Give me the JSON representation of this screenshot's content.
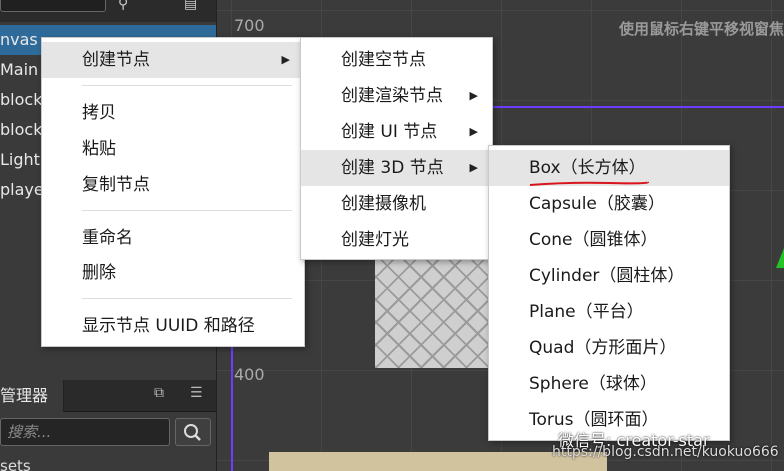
{
  "hierarchy": {
    "rows": [
      "nvas",
      "Main C",
      "block",
      "block",
      "Light",
      "player"
    ]
  },
  "assets": {
    "tab_label": "管理器",
    "search_placeholder": "搜索...",
    "first_row": "sets"
  },
  "scene": {
    "hint": "使用鼠标右键平移视窗焦",
    "label_700": "700",
    "label_400": "400"
  },
  "menu_main": {
    "items": [
      "创建节点",
      "拷贝",
      "粘贴",
      "复制节点",
      "重命名",
      "删除",
      "显示节点 UUID 和路径"
    ]
  },
  "menu_create": {
    "items": [
      "创建空节点",
      "创建渲染节点",
      "创建 UI 节点",
      "创建 3D 节点",
      "创建摄像机",
      "创建灯光"
    ]
  },
  "menu_3d": {
    "items": [
      "Box（长方体）",
      "Capsule（胶囊）",
      "Cone（圆锥体）",
      "Cylinder（圆柱体）",
      "Plane（平台）",
      "Quad（方形面片）",
      "Sphere（球体）",
      "Torus（圆环面）"
    ]
  },
  "watermark": {
    "line1": "微信号: creator-star",
    "line2": "https://blog.csdn.net/kuokuo666"
  },
  "colors": {
    "selection": "#2f6b9a",
    "axis": "#6c3cff",
    "underline": "#d8141c"
  }
}
